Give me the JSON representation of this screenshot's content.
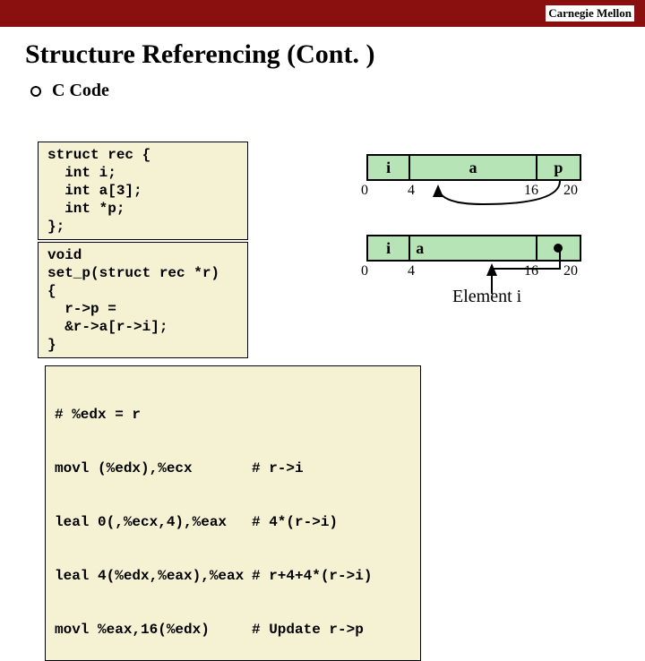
{
  "banner": {
    "university": "Carnegie Mellon"
  },
  "title": "Structure Referencing (Cont. )",
  "bullet": {
    "label": "C Code"
  },
  "code1": "struct rec {\n  int i;\n  int a[3];\n  int *p;\n};",
  "code2": "void\nset_p(struct rec *r)\n{\n  r->p =\n  &r->a[r->i];\n}",
  "asm": {
    "comment_line": "# %edx = r",
    "lines": [
      {
        "code": "movl (%edx),%ecx",
        "comment": "# r->i"
      },
      {
        "code": "leal 0(,%ecx,4),%eax",
        "comment": "# 4*(r->i)"
      },
      {
        "code": "leal 4(%edx,%eax),%eax",
        "comment": "# r+4+4*(r->i)"
      },
      {
        "code": "movl %eax,16(%edx)",
        "comment": "# Update r->p"
      }
    ]
  },
  "diagram": {
    "fields": {
      "i": "i",
      "a": "a",
      "p": "p"
    },
    "offsets": {
      "o0": "0",
      "o4": "4",
      "o16": "16",
      "o20": "20"
    },
    "element_label": "Element i"
  }
}
